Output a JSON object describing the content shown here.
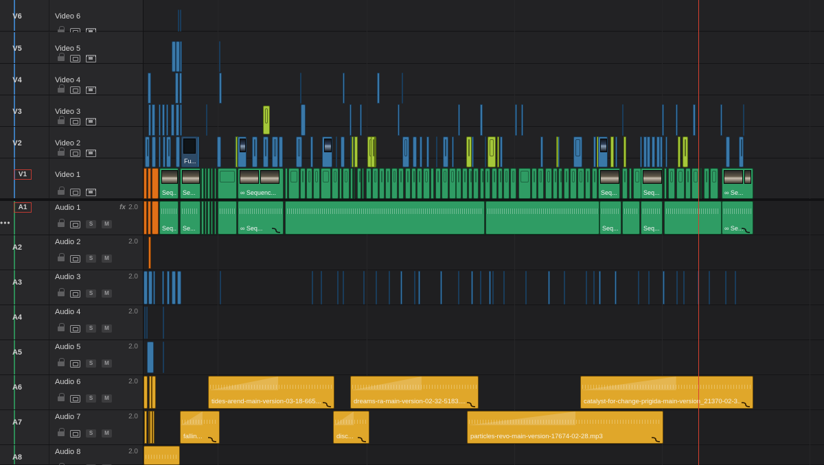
{
  "colors": {
    "video_strip": "#3d7ab8",
    "audio_strip": "#2e8b57",
    "playhead": "#d8402f",
    "clip_blue": "#3a78a8",
    "clip_lime": "#a5c73a",
    "clip_green": "#2f9c64",
    "clip_gold": "#e0a72a",
    "clip_orange": "#e07018"
  },
  "video_tracks": [
    {
      "id": "V6",
      "name": "Video 6"
    },
    {
      "id": "V5",
      "name": "Video 5"
    },
    {
      "id": "V4",
      "name": "Video 4"
    },
    {
      "id": "V3",
      "name": "Video 3"
    },
    {
      "id": "V2",
      "name": "Video 2"
    },
    {
      "id": "V1",
      "name": "Video 1"
    }
  ],
  "audio_tracks": [
    {
      "id": "A1",
      "name": "Audio 1",
      "channels": "2.0",
      "fx": "fx"
    },
    {
      "id": "A2",
      "name": "Audio 2",
      "channels": "2.0"
    },
    {
      "id": "A3",
      "name": "Audio 3",
      "channels": "2.0"
    },
    {
      "id": "A4",
      "name": "Audio 4",
      "channels": "2.0"
    },
    {
      "id": "A5",
      "name": "Audio 5",
      "channels": "2.0"
    },
    {
      "id": "A6",
      "name": "Audio 6",
      "channels": "2.0"
    },
    {
      "id": "A7",
      "name": "Audio 7",
      "channels": "2.0"
    },
    {
      "id": "A8",
      "name": "Audio 8",
      "channels": "2.0"
    }
  ],
  "solo_label": "S",
  "mute_label": "M",
  "more_label": "•••",
  "clip_labels": {
    "v2_fusion": "Fu...",
    "v1_seq_a": "Seq...",
    "v1_seq_b": "Se...",
    "v1_sequence": "Sequenc...",
    "v1_seq_c": "Seq...",
    "v1_seq_d": "Seq...",
    "v1_seq_e": "Se...",
    "a1_seq_a": "Seq...",
    "a1_seq_b": "Se...",
    "a1_seq_c": "Seq...",
    "a1_seq_d": "Seq...",
    "a1_seq_e": "Seq...",
    "a1_seq_f": "Se...",
    "a6_clip1": "tides-arend-main-version-03-18-665...",
    "a6_clip2": "dreams-ra-main-version-02-32-5183....",
    "a6_clip3": "catalyst-for-change-prigida-main-version_21370-02-3...",
    "a7_clip1": "fallin...",
    "a7_clip2": "disc...",
    "a7_clip3": "particles-revo-main-version-17674-02-28.mp3"
  }
}
